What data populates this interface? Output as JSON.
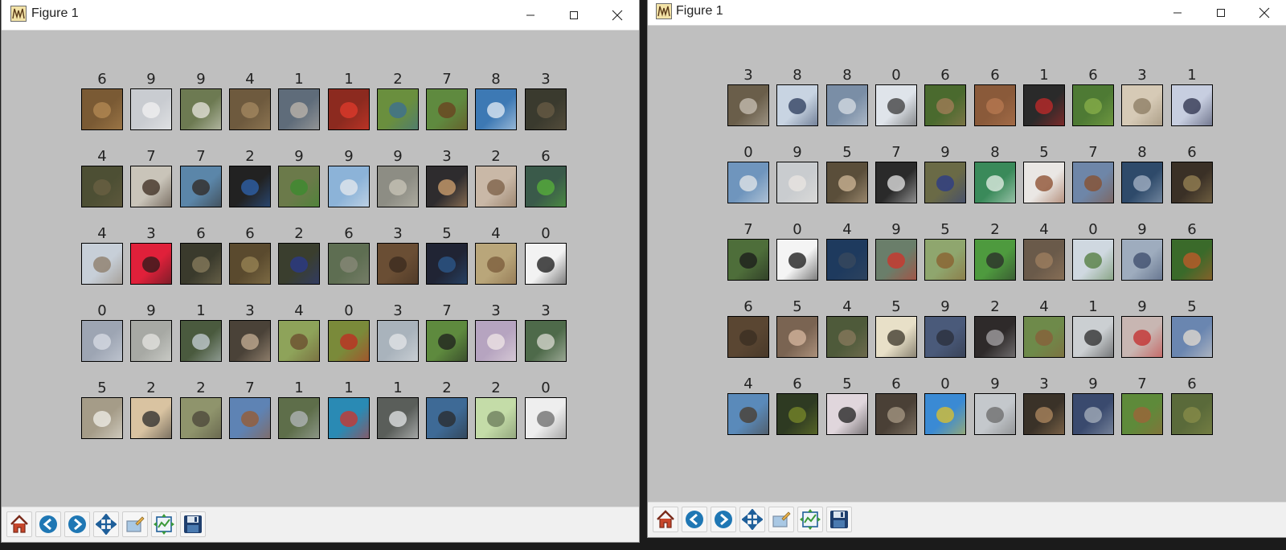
{
  "windows": [
    {
      "title": "Figure 1",
      "grid": [
        [
          {
            "label": "6",
            "bg": "#7a5a34",
            "fg": "#b58b54"
          },
          {
            "label": "9",
            "bg": "#c9ccd1",
            "fg": "#f2f2f2"
          },
          {
            "label": "9",
            "bg": "#6d7a52",
            "fg": "#e9e7e0"
          },
          {
            "label": "4",
            "bg": "#6e5a3e",
            "fg": "#a58a62"
          },
          {
            "label": "1",
            "bg": "#5f6c7a",
            "fg": "#bfb7ad"
          },
          {
            "label": "1",
            "bg": "#8c2a1f",
            "fg": "#e23b2c"
          },
          {
            "label": "2",
            "bg": "#6a8f3e",
            "fg": "#3b6e95"
          },
          {
            "label": "7",
            "bg": "#5f8a3f",
            "fg": "#6b3f1f"
          },
          {
            "label": "8",
            "bg": "#3d79b4",
            "fg": "#e6eef5"
          },
          {
            "label": "3",
            "bg": "#3a3a2e",
            "fg": "#6a5c46"
          }
        ],
        [
          {
            "label": "4",
            "bg": "#4d4f34",
            "fg": "#6b6043"
          },
          {
            "label": "7",
            "bg": "#c9c4b9",
            "fg": "#3a2a1e"
          },
          {
            "label": "7",
            "bg": "#5b86a9",
            "fg": "#2f2620"
          },
          {
            "label": "2",
            "bg": "#222222",
            "fg": "#2f64b0"
          },
          {
            "label": "9",
            "bg": "#6b7a4a",
            "fg": "#3a8c2d"
          },
          {
            "label": "9",
            "bg": "#8cb3d8",
            "fg": "#e7eaee"
          },
          {
            "label": "9",
            "bg": "#8d8d84",
            "fg": "#c9c5b8"
          },
          {
            "label": "3",
            "bg": "#2e2c2e",
            "fg": "#d3a370"
          },
          {
            "label": "2",
            "bg": "#c9b8a7",
            "fg": "#7a5e44"
          },
          {
            "label": "6",
            "bg": "#3a5a4a",
            "fg": "#58b33a"
          }
        ],
        [
          {
            "label": "4",
            "bg": "#c7cfd8",
            "fg": "#8b7a66"
          },
          {
            "label": "3",
            "bg": "#e0203a",
            "fg": "#2a1a1a"
          },
          {
            "label": "6",
            "bg": "#3a3a2c",
            "fg": "#8a7e5e"
          },
          {
            "label": "6",
            "bg": "#5a4a2e",
            "fg": "#9a8656"
          },
          {
            "label": "2",
            "bg": "#3a3e2e",
            "fg": "#2a3a8e"
          },
          {
            "label": "6",
            "bg": "#5e6e52",
            "fg": "#8a8a7a"
          },
          {
            "label": "3",
            "bg": "#6a4e34",
            "fg": "#3a2a1e"
          },
          {
            "label": "5",
            "bg": "#202434",
            "fg": "#2c5a8e"
          },
          {
            "label": "4",
            "bg": "#b9a67a",
            "fg": "#7a5a3a"
          },
          {
            "label": "0",
            "bg": "#f2f2f2",
            "fg": "#141414"
          }
        ],
        [
          {
            "label": "0",
            "bg": "#9da5b3",
            "fg": "#d9dde5"
          },
          {
            "label": "9",
            "bg": "#a7a9a4",
            "fg": "#e6e6e2"
          },
          {
            "label": "1",
            "bg": "#4a5a3e",
            "fg": "#c8d2d8"
          },
          {
            "label": "3",
            "bg": "#4a4238",
            "fg": "#c7b096"
          },
          {
            "label": "4",
            "bg": "#8ea35a",
            "fg": "#6a4a2e"
          },
          {
            "label": "0",
            "bg": "#7a8a3a",
            "fg": "#c22a22"
          },
          {
            "label": "3",
            "bg": "#a9b3bc",
            "fg": "#e4e6e8"
          },
          {
            "label": "7",
            "bg": "#5e8a3e",
            "fg": "#1e1e1e"
          },
          {
            "label": "3",
            "bg": "#b6a4c0",
            "fg": "#f0e7e7"
          },
          {
            "label": "3",
            "bg": "#4e6a4a",
            "fg": "#dcdcd4"
          }
        ],
        [
          {
            "label": "5",
            "bg": "#a59c88",
            "fg": "#f2f0ea"
          },
          {
            "label": "2",
            "bg": "#d9c3a1",
            "fg": "#2a2a2a"
          },
          {
            "label": "2",
            "bg": "#8f946c",
            "fg": "#4a4438"
          },
          {
            "label": "7",
            "bg": "#5e83b4",
            "fg": "#9a5a2e"
          },
          {
            "label": "1",
            "bg": "#5e6e4a",
            "fg": "#b4b8bc"
          },
          {
            "label": "1",
            "bg": "#2a8ab4",
            "fg": "#d2322a"
          },
          {
            "label": "1",
            "bg": "#5a5e5a",
            "fg": "#e6e8ea"
          },
          {
            "label": "2",
            "bg": "#3e6a96",
            "fg": "#2a2a2a"
          },
          {
            "label": "2",
            "bg": "#c4dca8",
            "fg": "#6a7a5a"
          },
          {
            "label": "0",
            "bg": "#eeeeee",
            "fg": "#6a6a6a"
          }
        ]
      ]
    },
    {
      "title": "Figure 1",
      "grid": [
        [
          {
            "label": "3",
            "bg": "#6a5e4a",
            "fg": "#c9c2b6"
          },
          {
            "label": "8",
            "bg": "#c8d4e2",
            "fg": "#2a3a5a"
          },
          {
            "label": "8",
            "bg": "#7a8ea6",
            "fg": "#d8dde4"
          },
          {
            "label": "0",
            "bg": "#dfe4ea",
            "fg": "#3a3a3a"
          },
          {
            "label": "6",
            "bg": "#4a6a2e",
            "fg": "#a67e5a"
          },
          {
            "label": "6",
            "bg": "#8a5a3a",
            "fg": "#b87a52"
          },
          {
            "label": "1",
            "bg": "#2a2a2a",
            "fg": "#c42a2a"
          },
          {
            "label": "6",
            "bg": "#4e7a34",
            "fg": "#8ab04a"
          },
          {
            "label": "3",
            "bg": "#d6cab6",
            "fg": "#8a7a60"
          },
          {
            "label": "1",
            "bg": "#c7cee0",
            "fg": "#2a2e4a"
          }
        ],
        [
          {
            "label": "0",
            "bg": "#6f95bd",
            "fg": "#e6e8ea"
          },
          {
            "label": "9",
            "bg": "#c9cccf",
            "fg": "#e9e6e1"
          },
          {
            "label": "5",
            "bg": "#5a4e3a",
            "fg": "#d0b898"
          },
          {
            "label": "7",
            "bg": "#2a2a2a",
            "fg": "#e8e8e8"
          },
          {
            "label": "9",
            "bg": "#6a6a46",
            "fg": "#2a3a8a"
          },
          {
            "label": "8",
            "bg": "#3a8a5a",
            "fg": "#e8f0ea"
          },
          {
            "label": "5",
            "bg": "#eae7e4",
            "fg": "#8a4a2a"
          },
          {
            "label": "7",
            "bg": "#6e86a8",
            "fg": "#8a4e2a"
          },
          {
            "label": "8",
            "bg": "#2e4a6a",
            "fg": "#a8b6c8"
          },
          {
            "label": "6",
            "bg": "#3a3026",
            "fg": "#9a8456"
          }
        ],
        [
          {
            "label": "7",
            "bg": "#4e6e3a",
            "fg": "#1a1a1a"
          },
          {
            "label": "0",
            "bg": "#f4f4f4",
            "fg": "#141414"
          },
          {
            "label": "4",
            "bg": "#1e3a5e",
            "fg": "#3a4a5e"
          },
          {
            "label": "9",
            "bg": "#6a7e6a",
            "fg": "#d2322a"
          },
          {
            "label": "5",
            "bg": "#8fa66e",
            "fg": "#8a5e2e"
          },
          {
            "label": "2",
            "bg": "#4e9a3e",
            "fg": "#2a2a2a"
          },
          {
            "label": "4",
            "bg": "#6a5a4a",
            "fg": "#a08060"
          },
          {
            "label": "0",
            "bg": "#cfd8e0",
            "fg": "#4e7a3a"
          },
          {
            "label": "9",
            "bg": "#9eacbe",
            "fg": "#3a4a6a"
          },
          {
            "label": "6",
            "bg": "#3a6a2a",
            "fg": "#c45a2a"
          }
        ],
        [
          {
            "label": "6",
            "bg": "#5a4632",
            "fg": "#3a2e22"
          },
          {
            "label": "5",
            "bg": "#7a6452",
            "fg": "#d8b8a0"
          },
          {
            "label": "4",
            "bg": "#4e5a3a",
            "fg": "#8a7a5e"
          },
          {
            "label": "5",
            "bg": "#e8e0c8",
            "fg": "#3a3428"
          },
          {
            "label": "9",
            "bg": "#4a5a7a",
            "fg": "#2a2e3a"
          },
          {
            "label": "2",
            "bg": "#2e2a2a",
            "fg": "#a8a6a8"
          },
          {
            "label": "4",
            "bg": "#6e8a4a",
            "fg": "#8a5e3a"
          },
          {
            "label": "1",
            "bg": "#cbcfd2",
            "fg": "#2a2a2a"
          },
          {
            "label": "9",
            "bg": "#c8b6b2",
            "fg": "#c42a2a"
          },
          {
            "label": "5",
            "bg": "#6a86b0",
            "fg": "#e6dcd0"
          }
        ],
        [
          {
            "label": "4",
            "bg": "#5a8aba",
            "fg": "#4a3a2a"
          },
          {
            "label": "6",
            "bg": "#2e3a22",
            "fg": "#7a8a2a"
          },
          {
            "label": "5",
            "bg": "#e0d6dc",
            "fg": "#1e1e1e"
          },
          {
            "label": "6",
            "bg": "#4a4036",
            "fg": "#a89a86"
          },
          {
            "label": "0",
            "bg": "#3a8ad4",
            "fg": "#e0c22a"
          },
          {
            "label": "9",
            "bg": "#c4c8cc",
            "fg": "#6a6a6a"
          },
          {
            "label": "3",
            "bg": "#3a3228",
            "fg": "#b08a60"
          },
          {
            "label": "9",
            "bg": "#3a4a6e",
            "fg": "#a8b2be"
          },
          {
            "label": "7",
            "bg": "#5e8a3a",
            "fg": "#a0623a"
          },
          {
            "label": "6",
            "bg": "#5a6a3a",
            "fg": "#8a8e4a"
          }
        ]
      ]
    }
  ],
  "toolbar": {
    "tools": [
      {
        "name": "home-button",
        "icon": "home-icon"
      },
      {
        "name": "back-button",
        "icon": "back-arrow-icon"
      },
      {
        "name": "forward-button",
        "icon": "forward-arrow-icon"
      },
      {
        "name": "pan-button",
        "icon": "move-icon"
      },
      {
        "name": "zoom-button",
        "icon": "zoom-rect-icon"
      },
      {
        "name": "subplots-button",
        "icon": "subplots-icon"
      },
      {
        "name": "save-button",
        "icon": "save-icon"
      }
    ]
  }
}
